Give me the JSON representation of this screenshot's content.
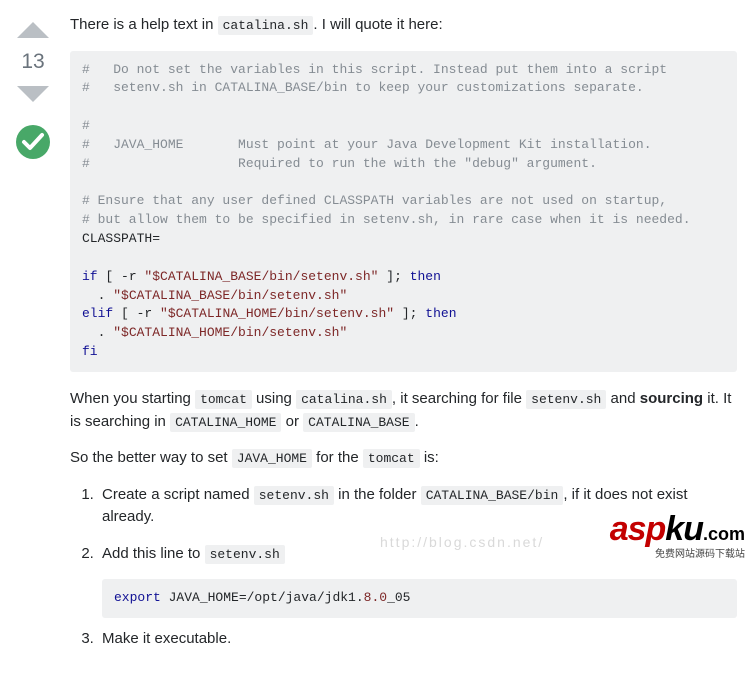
{
  "vote": {
    "score": "13"
  },
  "intro": {
    "t1": "There is a help text in ",
    "c1": "catalina.sh",
    "t2": ". I will quote it here:"
  },
  "code1": {
    "l1": "#   Do not set the variables in this script. Instead put them into a script",
    "l2": "#   setenv.sh in CATALINA_BASE/bin to keep your customizations separate.",
    "l3": "#",
    "l4": "#   JAVA_HOME       Must point at your Java Development Kit installation.",
    "l5": "#                   Required to run the with the \"debug\" argument.",
    "l6": "# Ensure that any user defined CLASSPATH variables are not used on startup,",
    "l7": "# but allow them to be specified in setenv.sh, in rare case when it is needed.",
    "l8": "CLASSPATH=",
    "k_if": "if",
    "k_then": "then",
    "k_elif": "elif",
    "k_fi": "fi",
    "b1a": " [ -r ",
    "s1": "\"$CATALINA_BASE/bin/setenv.sh\"",
    "b1b": " ]; ",
    "dot": "  . ",
    "s2": "\"$CATALINA_BASE/bin/setenv.sh\"",
    "s3": "\"$CATALINA_HOME/bin/setenv.sh\"",
    "s4": "\"$CATALINA_HOME/bin/setenv.sh\""
  },
  "para2": {
    "t1": "When you starting ",
    "c1": "tomcat",
    "t2": " using ",
    "c2": "catalina.sh",
    "t3": ", it searching for file ",
    "c3": "setenv.sh",
    "t4": " and ",
    "b1": "sourcing",
    "t5": " it. It is searching in ",
    "c4": "CATALINA_HOME",
    "t6": " or ",
    "c5": "CATALINA_BASE",
    "t7": "."
  },
  "para3": {
    "t1": "So the better way to set ",
    "c1": "JAVA_HOME",
    "t2": " for the ",
    "c2": "tomcat",
    "t3": " is:"
  },
  "steps": {
    "s1": {
      "t1": "Create a script named ",
      "c1": "setenv.sh",
      "t2": " in the folder ",
      "c2": "CATALINA_BASE/bin",
      "t3": ", if it does not exist already."
    },
    "s2": {
      "t1": "Add this line to ",
      "c1": "setenv.sh"
    },
    "s2code": {
      "kw": "export",
      "mid": " JAVA_HOME=/opt/java/jdk1.",
      "n1": "8.0",
      "tail": "_05"
    },
    "s3": {
      "t1": "Make it executable."
    }
  },
  "watermark": {
    "asp": "asp",
    "ku": "ku",
    "com": ".com",
    "sub": "免费网站源码下载站",
    "url": "http://blog.csdn.net/"
  }
}
